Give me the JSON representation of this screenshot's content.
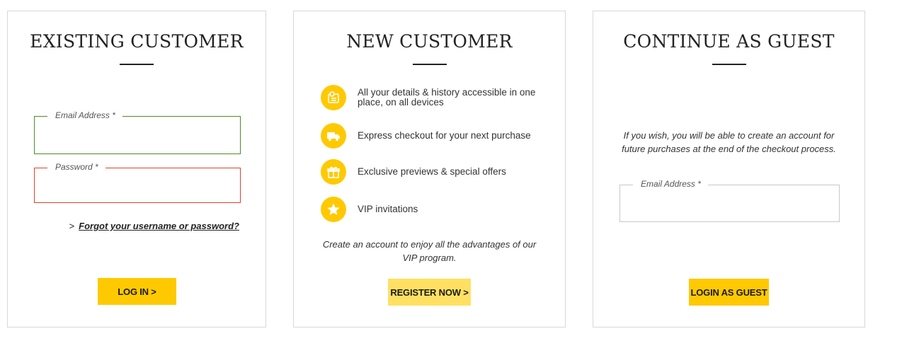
{
  "existing_customer": {
    "title": "EXISTING CUSTOMER",
    "email_label": "Email Address *",
    "email_value": "",
    "password_label": "Password *",
    "password_value": "",
    "forgot_chevron": ">",
    "forgot_link": "Forgot your username or password?",
    "login_button": "LOG IN >",
    "email_border_color": "#4f8a2d",
    "password_border_color": "#d9432f"
  },
  "new_customer": {
    "title": "NEW CUSTOMER",
    "benefits": [
      {
        "icon": "user-profile-icon",
        "text": "All your details & history accessible in one place, on all devices"
      },
      {
        "icon": "delivery-truck-icon",
        "text": "Express checkout for your next purchase"
      },
      {
        "icon": "gift-icon",
        "text": "Exclusive previews & special offers"
      },
      {
        "icon": "star-icon",
        "text": "VIP invitations"
      }
    ],
    "note": "Create an account to enjoy all the advantages of our VIP program.",
    "register_button": "REGISTER NOW >"
  },
  "guest": {
    "title": "CONTINUE AS GUEST",
    "note": "If you wish, you will be able to create an account for future purchases at the end of the checkout process.",
    "email_label": "Email Address *",
    "email_value": "",
    "guest_button": "LOGIN AS GUEST"
  },
  "colors": {
    "accent": "#ffc901",
    "accent_light": "#ffe062",
    "border": "#d8d8d8",
    "text": "#222222"
  }
}
